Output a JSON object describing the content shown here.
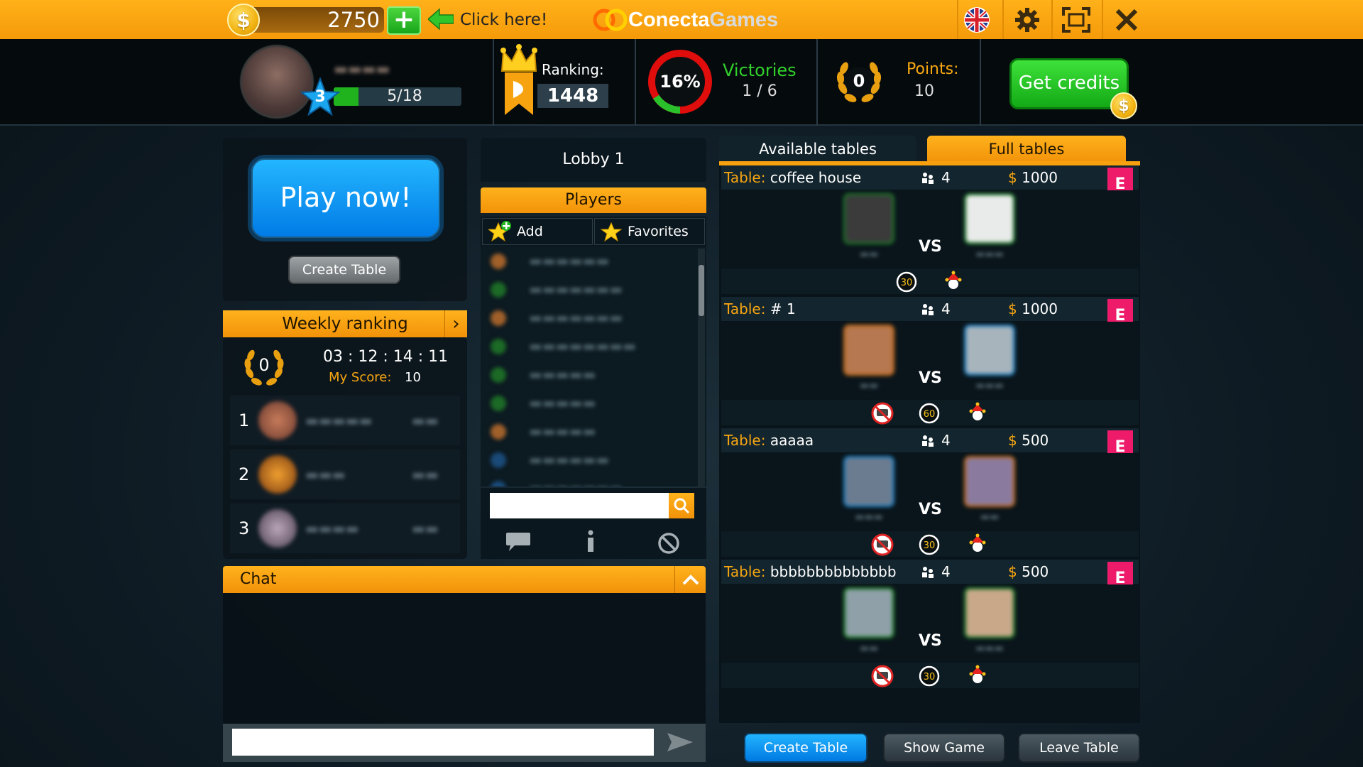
{
  "topbar": {
    "credits": "2750",
    "add_symbol": "+",
    "coin_symbol": "$",
    "click_here": "Click here!",
    "logo_part1": "Conecta",
    "logo_part2": "Games",
    "icons": [
      "uk-flag-icon",
      "gear-icon",
      "fullscreen-icon",
      "close-icon"
    ]
  },
  "profile": {
    "level": "3",
    "xp": "5/18",
    "xp_fraction": 0.28,
    "ranking_label": "Ranking:",
    "ranking_value": "1448",
    "win_percent": "16%",
    "win_fraction": 0.16,
    "victories_label": "Victories",
    "victories_value": "1 / 6",
    "laurel_value": "0",
    "points_label": "Points:",
    "points_value": "10",
    "get_credits": "Get credits"
  },
  "play": {
    "play_now": "Play now!",
    "create_table": "Create Table"
  },
  "weekly": {
    "title": "Weekly ranking",
    "laurel_value": "0",
    "timer": "03 : 12 : 14 : 11",
    "my_score_label": "My Score:",
    "my_score_value": "10",
    "rows": [
      {
        "rank": "1"
      },
      {
        "rank": "2"
      },
      {
        "rank": "3"
      }
    ]
  },
  "lobby": {
    "title": "Lobby 1",
    "players_title": "Players",
    "add_label": "Add",
    "favorites_label": "Favorites",
    "search_placeholder": ""
  },
  "tables": {
    "tab_available": "Available tables",
    "tab_full": "Full tables",
    "table_label": "Table:",
    "ribbon_letter": "E",
    "vs": "VS",
    "list": [
      {
        "name": "coffee house",
        "players": "4",
        "bet": "1000",
        "timer": "30"
      },
      {
        "name": "# 1",
        "players": "4",
        "bet": "1000",
        "timer": "60"
      },
      {
        "name": "aaaaa",
        "players": "4",
        "bet": "500",
        "timer": "30"
      },
      {
        "name": "bbbbbbbbbbbbbb",
        "players": "4",
        "bet": "500",
        "timer": "30"
      }
    ],
    "create_table": "Create Table",
    "show_game": "Show Game",
    "leave_table": "Leave Table"
  },
  "chat": {
    "title": "Chat",
    "input_placeholder": ""
  },
  "colors": {
    "accent_orange": "#f7a10f",
    "play_blue": "#0a8cf0",
    "credits_green": "#18a51a",
    "ribbon_pink": "#ee1b6b"
  }
}
